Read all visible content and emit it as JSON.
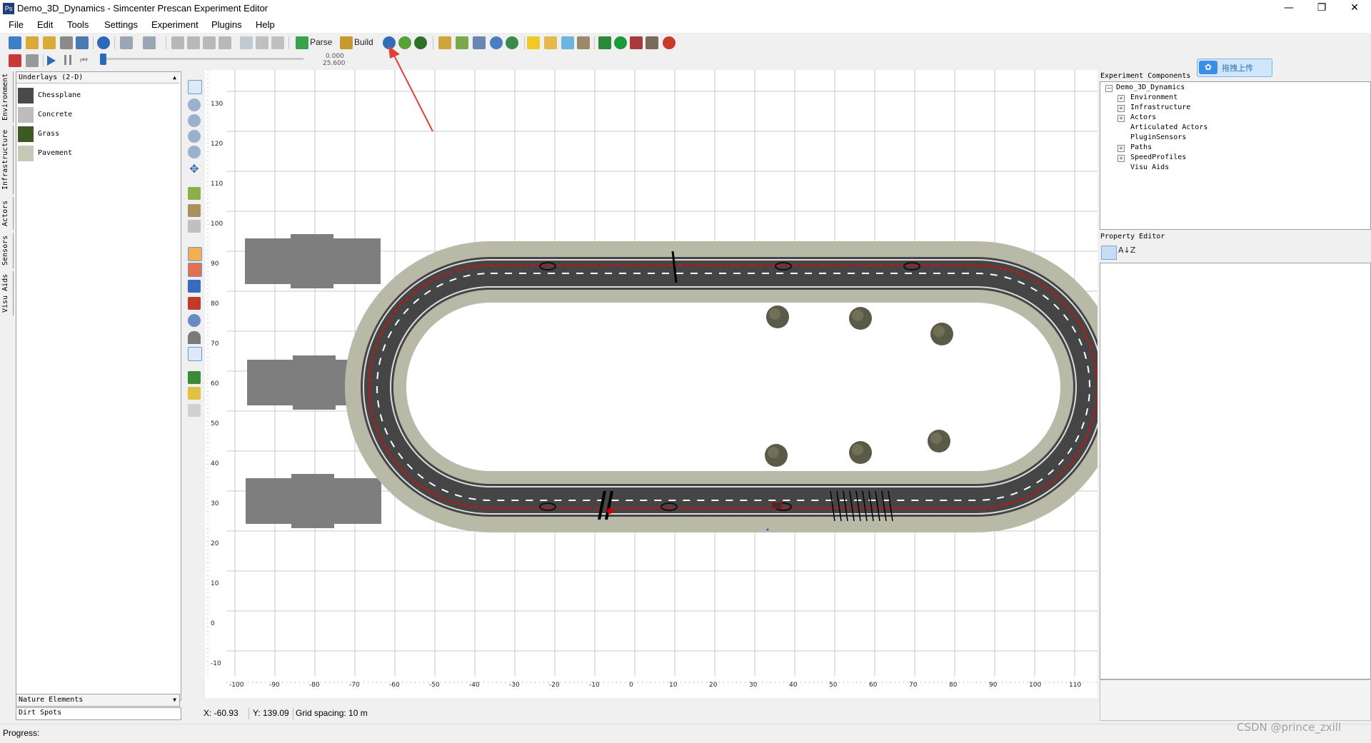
{
  "window": {
    "title": "Demo_3D_Dynamics - Simcenter Prescan Experiment Editor",
    "app_icon_text": "Ps",
    "minimize": "—",
    "restore": "❐",
    "close": "✕"
  },
  "menu": [
    "File",
    "Edit",
    "Tools",
    "Settings",
    "Experiment",
    "Plugins",
    "Help"
  ],
  "toolbar": {
    "parse_label": "Parse",
    "build_label": "Build",
    "time_current": "0.000",
    "time_end": "25.600"
  },
  "left_tabs": [
    "Environment",
    "Infrastructure",
    "Actors",
    "Sensors",
    "Visu Aids"
  ],
  "underlays": {
    "header": "Underlays (2-D)",
    "items": [
      {
        "label": "Chessplane",
        "color": "#4a4a4a"
      },
      {
        "label": "Concrete",
        "color": "#bdbdbd"
      },
      {
        "label": "Grass",
        "color": "#3d5a24"
      },
      {
        "label": "Pavement",
        "color": "#c8c8b8"
      }
    ]
  },
  "nature_elements": "Nature Elements",
  "dirt_spots": "Dirt Spots",
  "ruler": {
    "y_labels": [
      "130",
      "120",
      "110",
      "100",
      "90",
      "80",
      "70",
      "60",
      "50",
      "40",
      "30",
      "20",
      "10",
      "0",
      "-10"
    ],
    "x_labels": [
      "-100",
      "-90",
      "-80",
      "-70",
      "-60",
      "-50",
      "-40",
      "-30",
      "-20",
      "-10",
      "0",
      "10",
      "20",
      "30",
      "40",
      "50",
      "60",
      "70",
      "80",
      "90",
      "100",
      "110"
    ]
  },
  "status": {
    "x": "X: -60.93",
    "y": "Y: 139.09",
    "grid": "Grid spacing: 10 m",
    "progress": "Progress:"
  },
  "experiment_components": {
    "title": "Experiment Components",
    "root": "Demo_3D_Dynamics",
    "children": [
      {
        "label": "Environment",
        "expandable": true
      },
      {
        "label": "Infrastructure",
        "expandable": true
      },
      {
        "label": "Actors",
        "expandable": true
      },
      {
        "label": "Articulated Actors",
        "expandable": false
      },
      {
        "label": "PluginSensors",
        "expandable": false
      },
      {
        "label": "Paths",
        "expandable": true
      },
      {
        "label": "SpeedProfiles",
        "expandable": true
      },
      {
        "label": "Visu Aids",
        "expandable": false
      }
    ]
  },
  "property_editor": {
    "title": "Property Editor",
    "sort_label": "A↓Z"
  },
  "upload_button": {
    "label": "拖拽上传",
    "icon": "✿"
  },
  "watermark": "CSDN @prince_zxill",
  "colors": {
    "accent": "#3a8ee6",
    "road": "#4a4a4a",
    "path": "#d01010",
    "arrow": "#e0403a"
  }
}
